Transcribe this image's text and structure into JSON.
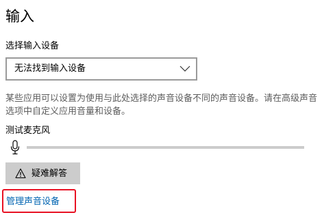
{
  "section": {
    "title": "输入"
  },
  "device_select": {
    "label": "选择输入设备",
    "selected": "无法找到输入设备"
  },
  "description": "某些应用可以设置为使用与此处选择的声音设备不同的声音设备。请在高级声音选项中自定义应用音量和设备。",
  "mic_test": {
    "label": "测试麦克风",
    "level": 0
  },
  "troubleshoot": {
    "label": "疑难解答"
  },
  "manage_link": {
    "label": "管理声音设备"
  },
  "colors": {
    "accent": "#0063b1",
    "button_bg": "#cccccc",
    "highlight": "#e81123",
    "secondary_text": "#5d5d5d"
  }
}
